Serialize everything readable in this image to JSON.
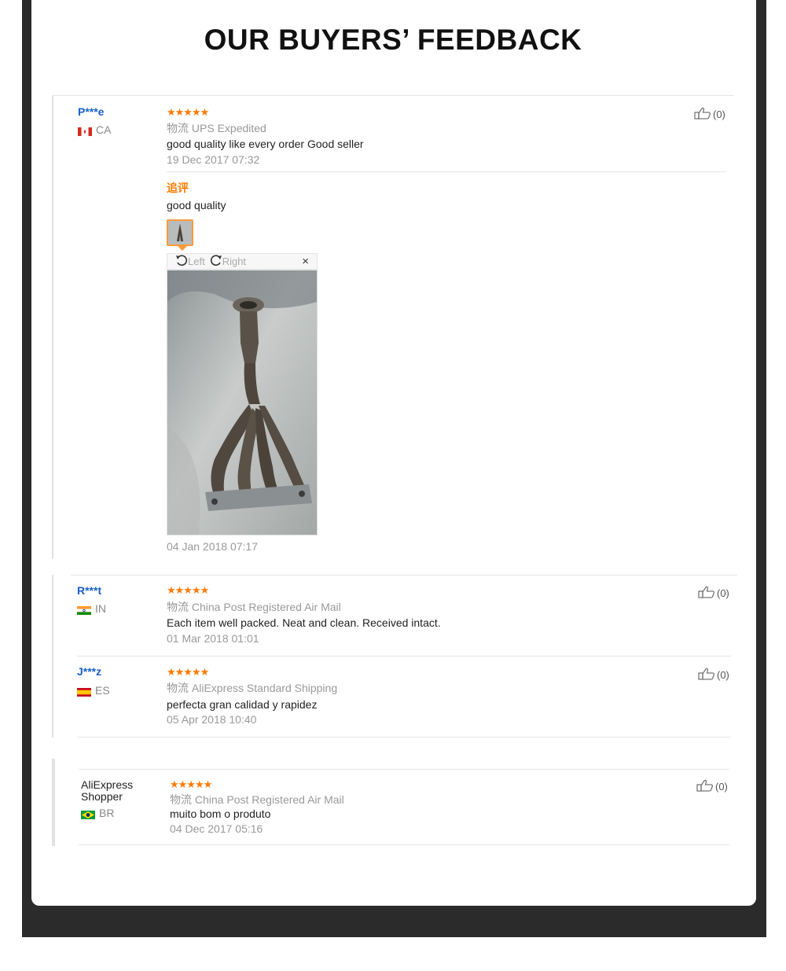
{
  "heading": "OUR BUYERS’ FEEDBACK",
  "reviews": [
    {
      "user": "P***e",
      "country": "CA",
      "stars": "★★★★★",
      "shipping_prefix": "物流",
      "shipping": "UPS Expedited",
      "text": "good quality like every order Good seller",
      "date": "19 Dec 2017 07:32",
      "helpful": "(0)",
      "additional": {
        "label": "追评",
        "text": "good quality",
        "viewer_left": "Left",
        "viewer_right": "Right",
        "viewer_close": "×",
        "date": "04 Jan 2018 07:17"
      }
    },
    {
      "user": "R***t",
      "country": "IN",
      "stars": "★★★★★",
      "shipping_prefix": "物流",
      "shipping": "China Post Registered Air Mail",
      "text": "Each item well packed. Neat and clean. Received intact.",
      "date": "01 Mar 2018 01:01",
      "helpful": "(0)"
    },
    {
      "user": "J***z",
      "country": "ES",
      "stars": "★★★★★",
      "shipping_prefix": "物流",
      "shipping": "AliExpress Standard Shipping",
      "text": "perfecta gran calidad y rapidez",
      "date": "05 Apr 2018 10:40",
      "helpful": "(0)"
    },
    {
      "user_line1": "AliExpress",
      "user_line2": "Shopper",
      "country": "BR",
      "stars": "★★★★★",
      "shipping_prefix": "物流",
      "shipping": "China Post Registered Air Mail",
      "text": "muito bom o produto",
      "date": "04 Dec 2017 05:16",
      "helpful": "(0)"
    }
  ],
  "colors": {
    "accent": "#ff7a00",
    "username": "#1a61c9",
    "frame": "#2b2b2b"
  },
  "icons": [
    "thumbs-up-icon",
    "rotate-left-icon",
    "rotate-right-icon",
    "close-icon",
    "flag-ca-icon",
    "flag-in-icon",
    "flag-es-icon",
    "flag-br-icon"
  ]
}
